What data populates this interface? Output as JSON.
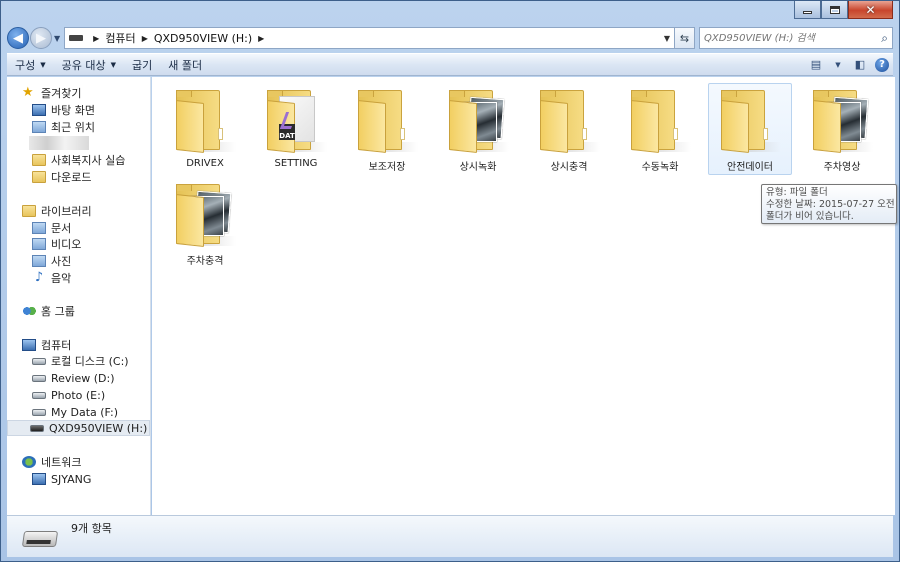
{
  "window": {
    "controls": {
      "minimize_icon": "minimize-icon",
      "maximize_icon": "maximize-icon",
      "close_label": "✕"
    }
  },
  "address": {
    "crumbs": [
      "컴퓨터",
      "QXD950VIEW (H:)"
    ],
    "search_placeholder": "QXD950VIEW (H:) 검색"
  },
  "toolbar": {
    "organize": "구성",
    "share": "공유 대상",
    "burn": "굽기",
    "new_folder": "새 폴더"
  },
  "nav": {
    "favorites": {
      "title": "즐겨찾기",
      "items": [
        "바탕 화면",
        "최근 위치",
        "",
        "사회복지사 실습",
        "다운로드"
      ]
    },
    "libraries": {
      "title": "라이브러리",
      "items": [
        "문서",
        "비디오",
        "사진",
        "음악"
      ]
    },
    "homegroup": {
      "title": "홈 그룹"
    },
    "computer": {
      "title": "컴퓨터",
      "items": [
        "로컬 디스크 (C:)",
        "Review (D:)",
        "Photo (E:)",
        "My Data (F:)",
        "QXD950VIEW (H:)"
      ]
    },
    "network": {
      "title": "네트워크",
      "items": [
        "SJYANG"
      ]
    }
  },
  "folders": [
    {
      "name": "DRIVEX",
      "kind": "plain"
    },
    {
      "name": "SETTING",
      "kind": "dat"
    },
    {
      "name": "보조저장",
      "kind": "plain"
    },
    {
      "name": "상시녹화",
      "kind": "photo"
    },
    {
      "name": "상시충격",
      "kind": "plain"
    },
    {
      "name": "수동녹화",
      "kind": "plain"
    },
    {
      "name": "안전데이터",
      "kind": "plain"
    },
    {
      "name": "주차영상",
      "kind": "photo"
    },
    {
      "name": "주차충격",
      "kind": "photo"
    }
  ],
  "tooltip": {
    "line1": "유형: 파일 폴더",
    "line2": "수정한 날짜: 2015-07-27 오전 1",
    "line3": "폴더가 비어 있습니다."
  },
  "status": {
    "count": "9개 항목"
  }
}
